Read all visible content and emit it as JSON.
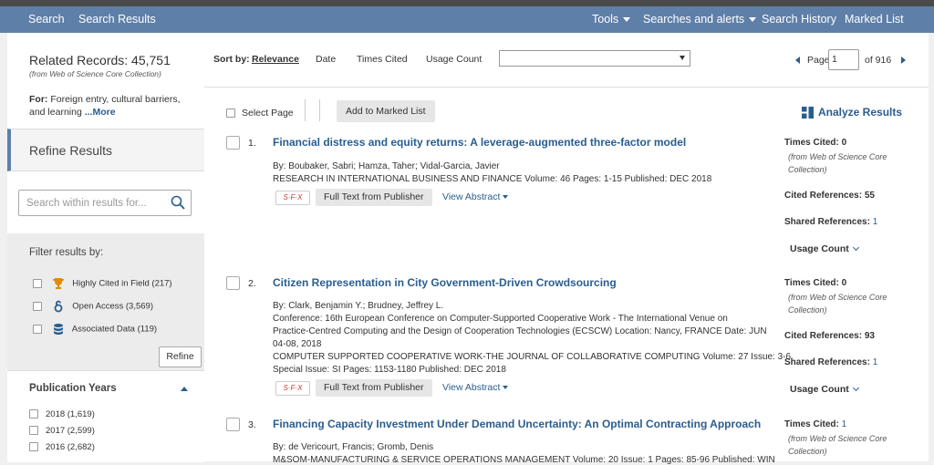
{
  "nav": {
    "search": "Search",
    "search_results": "Search Results",
    "tools": "Tools",
    "searches_alerts": "Searches and alerts",
    "search_history": "Search History",
    "marked_list": "Marked List"
  },
  "sidebar": {
    "related_records": "Related Records: 45,751",
    "related_source": "(from Web of Science Core Collection)",
    "for_label": "For:",
    "for_text": "Foreign entry, cultural barriers, and learning",
    "more": "...More",
    "refine_results": "Refine Results",
    "search_placeholder": "Search within results for...",
    "filter_title": "Filter results by:",
    "filters": [
      {
        "label": "Highly Cited in Field (217)",
        "icon": "trophy-icon"
      },
      {
        "label": "Open Access (3,569)",
        "icon": "open-access-icon"
      },
      {
        "label": "Associated Data (119)",
        "icon": "database-icon"
      }
    ],
    "refine_button": "Refine",
    "pub_years_title": "Publication Years",
    "years": [
      "2018 (1,619)",
      "2017 (2,599)",
      "2016 (2,682)"
    ]
  },
  "sortbar": {
    "label": "Sort by:",
    "options": [
      "Relevance",
      "Date",
      "Times Cited",
      "Usage Count"
    ],
    "active": "Relevance",
    "page_label": "Page",
    "page_value": "1",
    "page_of": "of 916"
  },
  "toolbar": {
    "select_page": "Select Page",
    "add_marked": "Add to Marked List",
    "analyze": "Analyze Results"
  },
  "records": [
    {
      "num": "1.",
      "title": "Financial distress and equity returns: A leverage-augmented three-factor model",
      "authors": "By: Boubaker, Sabri; Hamza, Taher; Vidal-Garcia, Javier",
      "source_lines": [
        "RESEARCH IN INTERNATIONAL BUSINESS AND FINANCE   Volume: 46   Pages: 1-15   Published: DEC 2018"
      ],
      "times_cited": "0",
      "cited_refs": "55",
      "shared_refs": "1"
    },
    {
      "num": "2.",
      "title": "Citizen Representation in City Government-Driven Crowdsourcing",
      "authors": "By: Clark, Benjamin Y.; Brudney, Jeffrey L.",
      "source_lines": [
        "Conference: 16th European Conference on Computer-Supported Cooperative Work - The International Venue on",
        "Practice-Centred Computing and the Design of Cooperation Technologies (ECSCW) Location: Nancy, FRANCE Date: JUN",
        "04-08, 2018",
        "COMPUTER SUPPORTED COOPERATIVE WORK-THE JOURNAL OF COLLABORATIVE COMPUTING   Volume: 27   Issue: 3-6",
        "Special Issue: SI   Pages: 1153-1180   Published: DEC 2018"
      ],
      "times_cited": "0",
      "cited_refs": "93",
      "shared_refs": "1"
    },
    {
      "num": "3.",
      "title": "Financing Capacity Investment Under Demand Uncertainty: An Optimal Contracting Approach",
      "authors": "By: de Vericourt, Francis; Gromb, Denis",
      "source_lines": [
        "M&SOM-MANUFACTURING & SERVICE OPERATIONS MANAGEMENT   Volume: 20   Issue: 1   Pages: 85-96   Published: WIN"
      ],
      "times_cited": "1"
    }
  ],
  "labels": {
    "sfx": "S·F·X",
    "full_text": "Full Text from Publisher",
    "view_abstract": "View Abstract",
    "times_cited": "Times Cited:",
    "wos_source": "(from Web of Science Core Collection)",
    "cited_refs": "Cited References:",
    "shared_refs": "Shared References:",
    "usage_count": "Usage Count"
  },
  "colors": {
    "nav": "#5e7fa8",
    "link": "#2a5d8f",
    "trophy": "#e58a00",
    "open_access": "#2a5d8f",
    "database": "#2a5d8f"
  }
}
